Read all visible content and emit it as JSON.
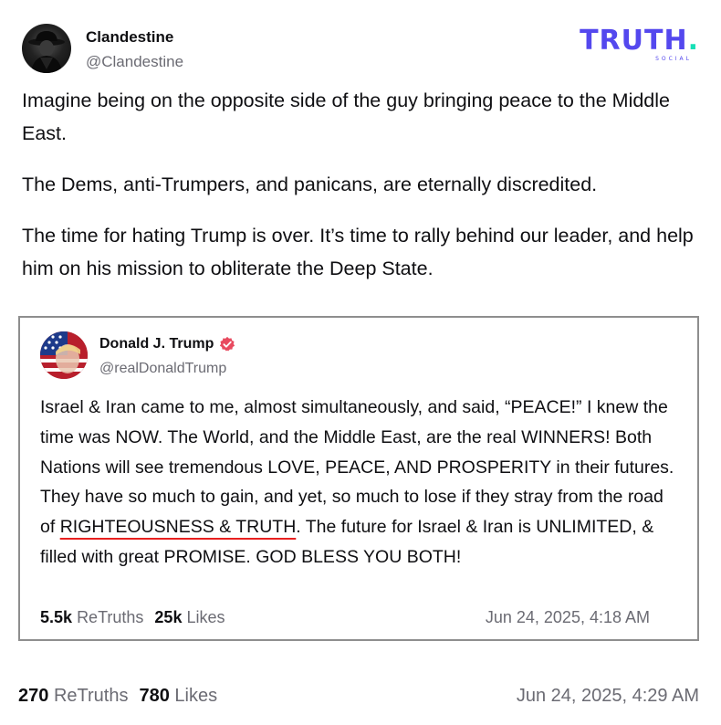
{
  "brand": {
    "word": "TRUTH",
    "dot": ".",
    "sub": "SOCIAL"
  },
  "post": {
    "author_name": "Clandestine",
    "author_handle": "@Clandestine",
    "paragraphs": [
      "Imagine being on the opposite side of the guy bringing peace to the Middle East.",
      "The Dems, anti-Trumpers, and panicans, are eternally discredited.",
      "The time for hating Trump is over. It’s time to rally behind our leader, and help him on his mission to obliterate the Deep State."
    ],
    "retruths_count": "270",
    "retruths_label": "ReTruths",
    "likes_count": "780",
    "likes_label": "Likes",
    "date": "Jun 24, 2025, 4:29 AM"
  },
  "quote": {
    "author_name": "Donald J. Trump",
    "author_handle": "@realDonaldTrump",
    "body_before": "Israel & Iran came to me, almost simultaneously, and said, “PEACE!” I knew the time was NOW. The World, and the Middle East, are the real WINNERS! Both Nations will see tremendous LOVE, PEACE, AND PROSPERITY in their futures. They have so much to gain, and yet, so much to lose if they stray from the road of ",
    "body_underlined": "RIGHTEOUSNESS & TRUTH",
    "body_after": ". The future for Israel & Iran is UNLIMITED, & filled with great PROMISE. GOD BLESS YOU BOTH!",
    "retruths_count": "5.5k",
    "retruths_label": "ReTruths",
    "likes_count": "25k",
    "likes_label": "Likes",
    "date": "Jun 24, 2025, 4:18 AM"
  },
  "icons": {
    "verified": "verified-badge-icon",
    "avatar": "avatar",
    "quote_avatar": "avatar"
  },
  "colors": {
    "brand": "#5448ee",
    "brand_dot": "#17e0b6",
    "verified": "#e84a5f",
    "underline": "#e8201f"
  }
}
